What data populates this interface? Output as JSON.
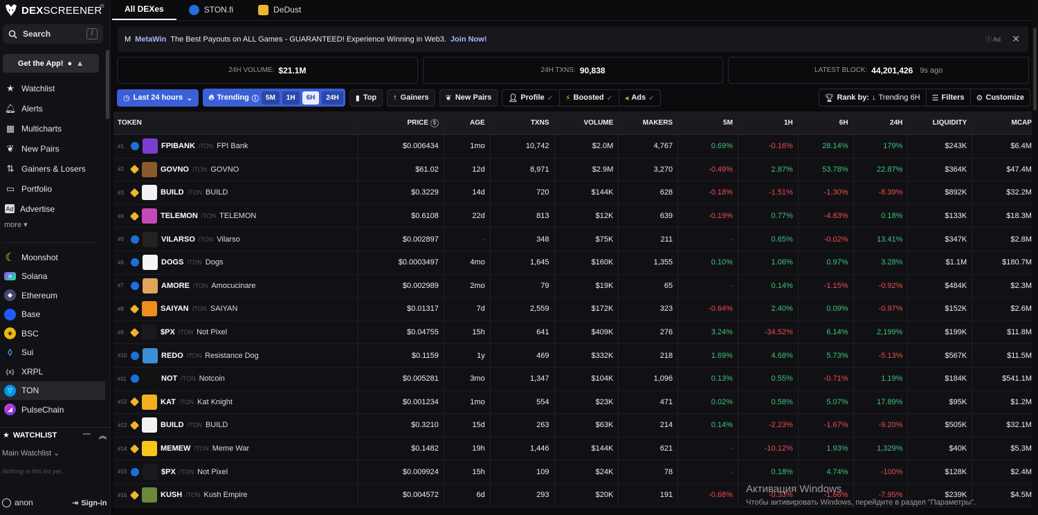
{
  "brand": {
    "bold": "DEX",
    "thin": "SCREENER"
  },
  "search": {
    "label": "Search",
    "shortcut": "/"
  },
  "get_app": "Get the App!",
  "nav": [
    {
      "label": "Watchlist",
      "icon": "star-icon"
    },
    {
      "label": "Alerts",
      "icon": "bell-icon"
    },
    {
      "label": "Multicharts",
      "icon": "grid-icon"
    },
    {
      "label": "New Pairs",
      "icon": "sprout-icon"
    },
    {
      "label": "Gainers & Losers",
      "icon": "arrows-icon"
    },
    {
      "label": "Portfolio",
      "icon": "portfolio-icon"
    },
    {
      "label": "Advertise",
      "icon": "ad-icon"
    }
  ],
  "more": "more",
  "chains": [
    {
      "label": "Moonshot",
      "color": "#d8e545",
      "glyph": "☾"
    },
    {
      "label": "Solana",
      "color": "#9945ff",
      "glyph": "≡"
    },
    {
      "label": "Ethereum",
      "color": "#6b7bb6",
      "glyph": "◆"
    },
    {
      "label": "Base",
      "color": "#1f5cf5",
      "glyph": ""
    },
    {
      "label": "BSC",
      "color": "#f0b90b",
      "glyph": "◈"
    },
    {
      "label": "Sui",
      "color": "#4ca3ff",
      "glyph": "◊"
    },
    {
      "label": "XRPL",
      "color": "#333338",
      "glyph": "{x}"
    },
    {
      "label": "TON",
      "color": "#0098ea",
      "glyph": "▽"
    },
    {
      "label": "PulseChain",
      "color": "#e23ad8",
      "glyph": "◢"
    }
  ],
  "watchlist": {
    "title": "WATCHLIST",
    "main": "Main Watchlist",
    "empty": "Nothing in this list yet..."
  },
  "footer": {
    "user": "anon",
    "signin": "Sign-in"
  },
  "tabs": [
    {
      "label": "All DEXes",
      "active": true
    },
    {
      "label": "STON.fi",
      "active": false
    },
    {
      "label": "DeDust",
      "active": false
    }
  ],
  "ad": {
    "brand": "MetaWin",
    "text": "The Best Payouts on ALL Games - GUARANTEED! Experience Winning in Web3.",
    "cta": "Join Now!",
    "tag": "Ad"
  },
  "stats": {
    "volume_label": "24H VOLUME:",
    "volume": "$21.1M",
    "txns_label": "24H TXNS:",
    "txns": "90,838",
    "block_label": "LATEST BLOCK:",
    "block": "44,201,426",
    "block_ago": "9s ago"
  },
  "filters": {
    "range": "Last 24 hours",
    "trending": "Trending",
    "timeframes": [
      "5M",
      "1H",
      "6H",
      "24H"
    ],
    "selected_tf": "6H",
    "top": "Top",
    "gainers": "Gainers",
    "new_pairs": "New Pairs",
    "profile": "Profile",
    "boosted": "Boosted",
    "ads": "Ads",
    "rank_by": "Rank by:",
    "rank_value": "Trending 6H",
    "filters": "Filters",
    "customize": "Customize"
  },
  "columns": [
    "TOKEN",
    "PRICE",
    "AGE",
    "TXNS",
    "VOLUME",
    "MAKERS",
    "5M",
    "1H",
    "6H",
    "24H",
    "LIQUIDITY",
    "MCAP"
  ],
  "rows": [
    {
      "rank": "#1",
      "chain": "ton",
      "sym": "FPIBANK",
      "quote": "TON",
      "name": "FPI Bank",
      "img": "#7a3fd1",
      "price": "$0.006434",
      "age": "1mo",
      "txns": "10,742",
      "vol": "$2.0M",
      "makers": "4,767",
      "p5": "0.69%",
      "p1": "-0.16%",
      "p6": "28.14%",
      "p24": "179%",
      "liq": "$243K",
      "mcap": "$6.4M"
    },
    {
      "rank": "#2",
      "chain": "dedust",
      "sym": "GOVNO",
      "quote": "TON",
      "name": "GOVNO",
      "img": "#8a5a2b",
      "price": "$61.02",
      "age": "12d",
      "txns": "8,971",
      "vol": "$2.9M",
      "makers": "3,270",
      "p5": "-0.49%",
      "p1": "2.87%",
      "p6": "53.78%",
      "p24": "22.87%",
      "liq": "$364K",
      "mcap": "$47.4M"
    },
    {
      "rank": "#3",
      "chain": "dedust",
      "sym": "BUILD",
      "quote": "TON",
      "name": "BUILD",
      "img": "#f2f2f2",
      "price": "$0.3229",
      "age": "14d",
      "txns": "720",
      "vol": "$144K",
      "makers": "628",
      "p5": "-0.18%",
      "p1": "-1.51%",
      "p6": "-1.30%",
      "p24": "-8.39%",
      "liq": "$892K",
      "mcap": "$32.2M"
    },
    {
      "rank": "#4",
      "chain": "dedust",
      "sym": "TELEMON",
      "quote": "TON",
      "name": "TELEMON",
      "img": "#c54ab8",
      "price": "$0.6108",
      "age": "22d",
      "txns": "813",
      "vol": "$12K",
      "makers": "639",
      "p5": "-0.19%",
      "p1": "0.77%",
      "p6": "-4.83%",
      "p24": "0.18%",
      "liq": "$133K",
      "mcap": "$18.3M"
    },
    {
      "rank": "#5",
      "chain": "ton",
      "sym": "VILARSO",
      "quote": "TON",
      "name": "Vilarso",
      "img": "#222",
      "price": "$0.002897",
      "age": "-",
      "txns": "348",
      "vol": "$75K",
      "makers": "211",
      "p5": "-",
      "p1": "0.65%",
      "p6": "-0.02%",
      "p24": "13.41%",
      "liq": "$347K",
      "mcap": "$2.8M"
    },
    {
      "rank": "#6",
      "chain": "ton",
      "sym": "DOGS",
      "quote": "TON",
      "name": "Dogs",
      "img": "#f5f5f5",
      "price": "$0.0003497",
      "age": "4mo",
      "txns": "1,645",
      "vol": "$160K",
      "makers": "1,355",
      "p5": "0.10%",
      "p1": "1.06%",
      "p6": "0.97%",
      "p24": "3.28%",
      "liq": "$1.1M",
      "mcap": "$180.7M"
    },
    {
      "rank": "#7",
      "chain": "ton",
      "sym": "AMORE",
      "quote": "TON",
      "name": "Amocucinare",
      "img": "#e0a55a",
      "price": "$0.002989",
      "age": "2mo",
      "txns": "79",
      "vol": "$19K",
      "makers": "65",
      "p5": "-",
      "p1": "0.14%",
      "p6": "-1.15%",
      "p24": "-0.92%",
      "liq": "$484K",
      "mcap": "$2.3M"
    },
    {
      "rank": "#8",
      "chain": "dedust",
      "sym": "SAIYAN",
      "quote": "TON",
      "name": "SAIYAN",
      "img": "#f08c1a",
      "price": "$0.01317",
      "age": "7d",
      "txns": "2,559",
      "vol": "$172K",
      "makers": "323",
      "p5": "-0.64%",
      "p1": "2.40%",
      "p6": "0.09%",
      "p24": "-0.97%",
      "liq": "$152K",
      "mcap": "$2.6M"
    },
    {
      "rank": "#9",
      "chain": "dedust",
      "sym": "$PX",
      "quote": "TON",
      "name": "Not Pixel",
      "img": "#1a1a1e",
      "price": "$0.04755",
      "age": "15h",
      "txns": "641",
      "vol": "$409K",
      "makers": "276",
      "p5": "3.24%",
      "p1": "-34.52%",
      "p6": "6.14%",
      "p24": "2,199%",
      "liq": "$199K",
      "mcap": "$11.8M"
    },
    {
      "rank": "#10",
      "chain": "ton",
      "sym": "REDO",
      "quote": "TON",
      "name": "Resistance Dog",
      "img": "#3a8fd6",
      "price": "$0.1159",
      "age": "1y",
      "txns": "469",
      "vol": "$332K",
      "makers": "218",
      "p5": "1.69%",
      "p1": "4.68%",
      "p6": "5.73%",
      "p24": "-5.13%",
      "liq": "$567K",
      "mcap": "$11.5M"
    },
    {
      "rank": "#11",
      "chain": "ton",
      "sym": "NOT",
      "quote": "TON",
      "name": "Notcoin",
      "img": "#111",
      "price": "$0.005281",
      "age": "3mo",
      "txns": "1,347",
      "vol": "$104K",
      "makers": "1,096",
      "p5": "0.13%",
      "p1": "0.55%",
      "p6": "-0.71%",
      "p24": "1.19%",
      "liq": "$184K",
      "mcap": "$541.1M"
    },
    {
      "rank": "#12",
      "chain": "dedust",
      "sym": "KAT",
      "quote": "TON",
      "name": "Kat Knight",
      "img": "#f2b01e",
      "price": "$0.001234",
      "age": "1mo",
      "txns": "554",
      "vol": "$23K",
      "makers": "471",
      "p5": "0.02%",
      "p1": "0.58%",
      "p6": "5.07%",
      "p24": "17.89%",
      "liq": "$95K",
      "mcap": "$1.2M"
    },
    {
      "rank": "#13",
      "chain": "dedust",
      "sym": "BUILD",
      "quote": "TON",
      "name": "BUILD",
      "img": "#f2f2f2",
      "price": "$0.3210",
      "age": "15d",
      "txns": "263",
      "vol": "$63K",
      "makers": "214",
      "p5": "0.14%",
      "p1": "-2.23%",
      "p6": "-1.67%",
      "p24": "-9.20%",
      "liq": "$505K",
      "mcap": "$32.1M"
    },
    {
      "rank": "#14",
      "chain": "dedust",
      "sym": "MEMEW",
      "quote": "TON",
      "name": "Meme War",
      "img": "#f5c81a",
      "price": "$0.1482",
      "age": "19h",
      "txns": "1,446",
      "vol": "$144K",
      "makers": "621",
      "p5": "-",
      "p1": "-10.12%",
      "p6": "1.93%",
      "p24": "1,329%",
      "liq": "$40K",
      "mcap": "$5.3M"
    },
    {
      "rank": "#15",
      "chain": "ton",
      "sym": "$PX",
      "quote": "TON",
      "name": "Not Pixel",
      "img": "#1a1a1e",
      "price": "$0.009924",
      "age": "15h",
      "txns": "109",
      "vol": "$24K",
      "makers": "78",
      "p5": "-",
      "p1": "0.18%",
      "p6": "4.74%",
      "p24": "-100%",
      "liq": "$128K",
      "mcap": "$2.4M"
    },
    {
      "rank": "#16",
      "chain": "dedust",
      "sym": "KUSH",
      "quote": "TON",
      "name": "Kush Empire",
      "img": "#6b8a3a",
      "price": "$0.004572",
      "age": "6d",
      "txns": "293",
      "vol": "$20K",
      "makers": "191",
      "p5": "-0.68%",
      "p1": "-0.33%",
      "p6": "-1.66%",
      "p24": "-7.95%",
      "liq": "$239K",
      "mcap": "$4.5M"
    }
  ],
  "watermark": {
    "line1": "Активация Windows",
    "line2": "Чтобы активировать Windows, перейдите в раздел \"Параметры\"."
  }
}
